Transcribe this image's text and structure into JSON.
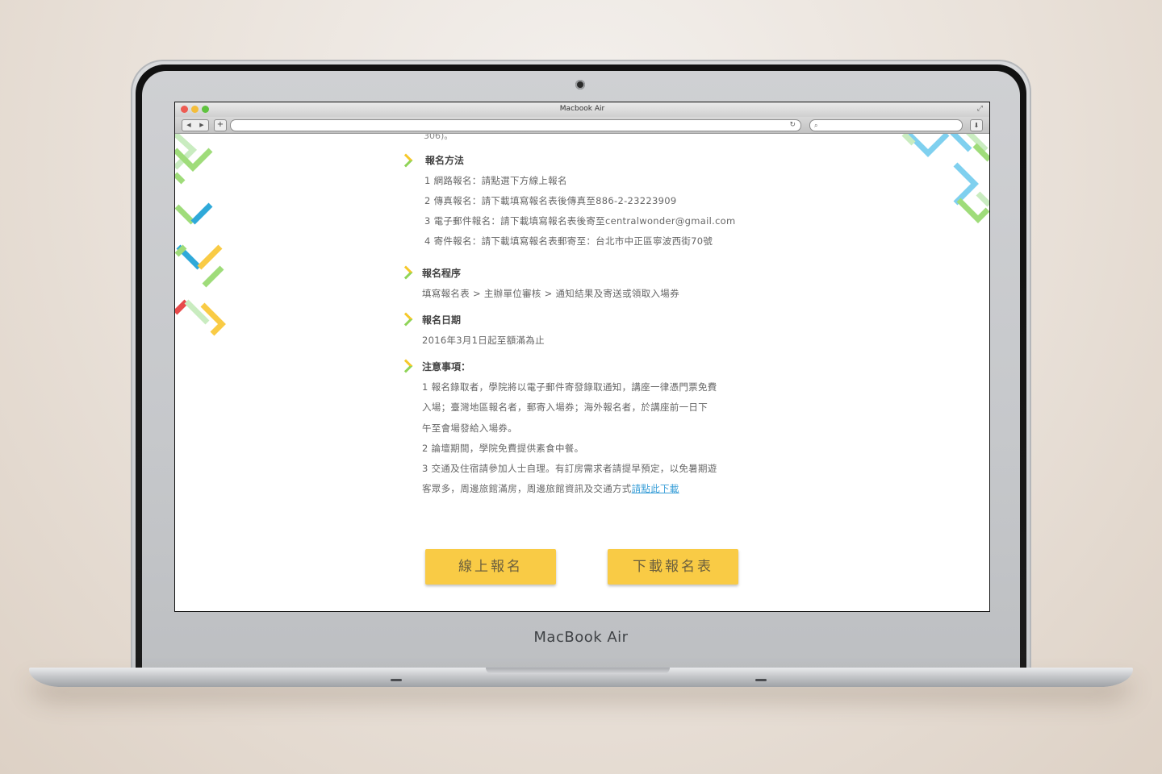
{
  "device": {
    "brand_label": "MacBook Air"
  },
  "browser": {
    "window_title": "Macbook Air",
    "back_icon": "back-arrow-icon",
    "forward_icon": "forward-arrow-icon",
    "new_tab_label": "+",
    "reload_icon": "↻",
    "search_icon": "⌕",
    "colors": {
      "close": "#ee5b52",
      "minimize": "#f4bd3a",
      "zoom": "#5fc33f"
    }
  },
  "page": {
    "cut_off_text": "306)。",
    "sections": [
      {
        "title": "報名方法",
        "lines": [
          "1  網路報名：請點選下方線上報名",
          "2  傳真報名：請下載填寫報名表後傳真至886-2-23223909",
          "3  電子郵件報名：請下載填寫報名表後寄至centralwonder@gmail.com",
          "4  寄件報名：請下載填寫報名表郵寄至：台北市中正區寧波西街70號"
        ]
      },
      {
        "title": "報名程序",
        "lines": [
          "填寫報名表  >  主辦單位審核  >  通知結果及寄送或領取入場券"
        ]
      },
      {
        "title": "報名日期",
        "lines": [
          "2016年3月1日起至額滿為止"
        ]
      },
      {
        "title": "注意事項：",
        "lines": [
          "1  報名錄取者，學院將以電子郵件寄發錄取通知，講座一律憑門票免費",
          "    入場；臺灣地區報名者，郵寄入場券；海外報名者，於講座前一日下",
          "    午至會場發給入場券。",
          "2  論壇期間，學院免費提供素食中餐。",
          "3  交通及住宿請參加人士自理。有訂房需求者請提早預定，以免暑期遊",
          "    客眾多，周邊旅館滿房，周邊旅館資訊及交通方式"
        ],
        "link_text": "請點此下載"
      }
    ],
    "buttons": {
      "register_online": "線上報名",
      "download_form": "下載報名表"
    },
    "accent_colors": {
      "yellow": "#f9cb45",
      "green": "#8fd458",
      "blue": "#2fa9d9",
      "red": "#e84a4a",
      "link": "#3a9fd8"
    }
  }
}
